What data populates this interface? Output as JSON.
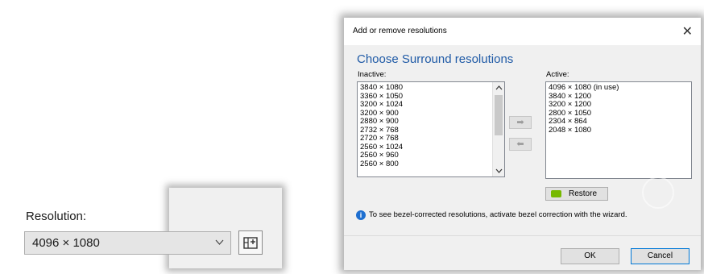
{
  "resolution_panel": {
    "label": "Resolution:",
    "selected_value": "4096 × 1080",
    "chevron_icon": "chevron-down-icon",
    "custom_button_icon": "custom-resolution-icon"
  },
  "dialog": {
    "title": "Add or remove resolutions",
    "close_glyph": "✕",
    "heading": "Choose Surround resolutions",
    "inactive_label": "Inactive:",
    "active_label": "Active:",
    "inactive_items": [
      "3840 × 1080",
      "3360 × 1050",
      "3200 × 1024",
      "3200 × 900",
      "2880 × 900",
      "2732 × 768",
      "2720 × 768",
      "2560 × 1024",
      "2560 × 960",
      "2560 × 800"
    ],
    "active_items": [
      "4096 × 1080 (in use)",
      "3840 × 1200",
      "3200 × 1200",
      "2800 × 1050",
      "2304 × 864",
      "2048 × 1080"
    ],
    "add_arrow": "➡",
    "remove_arrow": "⬅",
    "restore_label": "Restore",
    "info_text": "To see bezel-corrected resolutions, activate bezel correction with the wizard.",
    "ok_label": "OK",
    "cancel_label": "Cancel"
  },
  "colors": {
    "heading": "#1f5aa6",
    "nvidia_green": "#76b900",
    "focus_blue": "#0078d7"
  }
}
